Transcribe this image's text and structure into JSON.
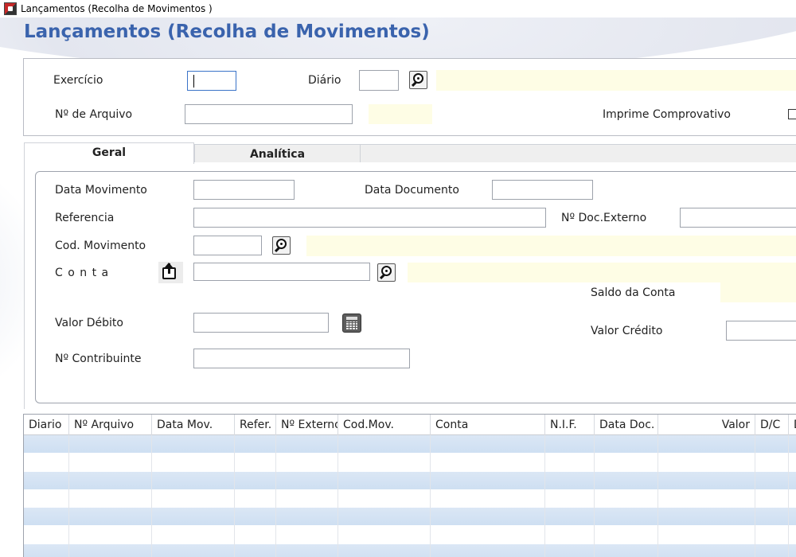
{
  "window": {
    "title": "Lançamentos (Recolha de Movimentos )"
  },
  "page": {
    "title": "Lançamentos (Recolha de Movimentos)"
  },
  "header_form": {
    "exercicio_label": "Exercício",
    "exercicio_value": "",
    "diario_label": "Diário",
    "diario_value": "",
    "arquivo_label": "Nº de Arquivo",
    "arquivo_value": "",
    "imprime_label": "Imprime Comprovativo"
  },
  "tabs": [
    {
      "label": "Geral",
      "active": true
    },
    {
      "label": "Analítica",
      "active": false
    }
  ],
  "geral_form": {
    "data_movimento_label": "Data Movimento",
    "data_documento_label": "Data Documento",
    "referencia_label": "Referencia",
    "doc_externo_label": "Nº Doc.Externo",
    "cod_movimento_label": "Cod. Movimento",
    "conta_label": "C o n t a",
    "saldo_label": "Saldo da Conta",
    "valor_debito_label": "Valor Débito",
    "valor_credito_label": "Valor Crédito",
    "contribuinte_label": "Nº Contribuinte"
  },
  "grid": {
    "columns": [
      "Diario",
      "Nº Arquivo",
      "Data Mov.",
      "Refer.",
      "Nº Externo",
      "Cod.Mov.",
      "Conta",
      "N.I.F.",
      "Data Doc.",
      "Valor",
      "D/C",
      "D"
    ],
    "rows": 7
  },
  "colors": {
    "title": "#3a63ad",
    "readonly_field": "#fefde5",
    "row_alt": "#dbe7f5"
  },
  "icons": [
    "app-icon",
    "search-icon",
    "share-icon",
    "calculator-icon"
  ]
}
